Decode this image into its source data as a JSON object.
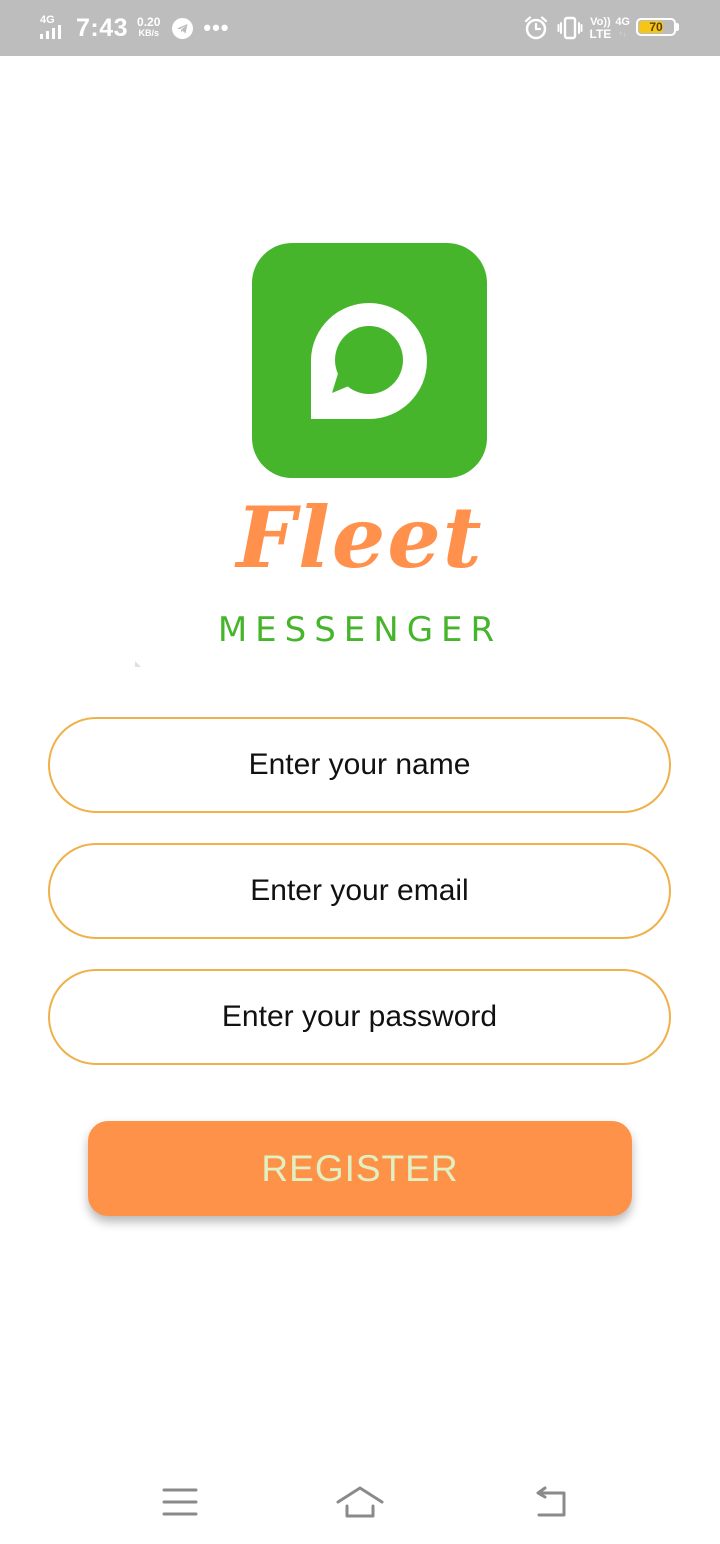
{
  "status_bar": {
    "network_type": "4G",
    "time": "7:43",
    "data_speed_value": "0.20",
    "data_speed_unit": "KB/s",
    "more_indicator": "•••",
    "volte_top": "Vo))",
    "volte_bottom": "LTE",
    "network_type_2": "4G",
    "network_type_2_sub": "↑↓",
    "battery_level": "70",
    "battery_percent": 70,
    "icons": [
      "signal-icon",
      "telegram-icon",
      "alarm-icon",
      "vibrate-icon",
      "battery-icon"
    ]
  },
  "branding": {
    "logo_icon": "chat-bubble-icon",
    "app_name": "Fleet",
    "app_tagline": "MESSENGER"
  },
  "form": {
    "name_placeholder": "Enter your name",
    "email_placeholder": "Enter your email",
    "password_placeholder": "Enter your password",
    "name_value": "",
    "email_value": "",
    "password_value": "",
    "register_label": "REGISTER"
  },
  "nav_bar": {
    "icons": [
      "menu-icon",
      "home-icon",
      "back-icon"
    ]
  },
  "colors": {
    "status_bar": "#bdbdbd",
    "logo_green": "#46b52c",
    "brand_orange": "#ff914d",
    "field_border": "#f0b04a",
    "button_bg": "#ff9249",
    "button_text": "#dff0c3",
    "battery_fill": "#f5c518"
  }
}
